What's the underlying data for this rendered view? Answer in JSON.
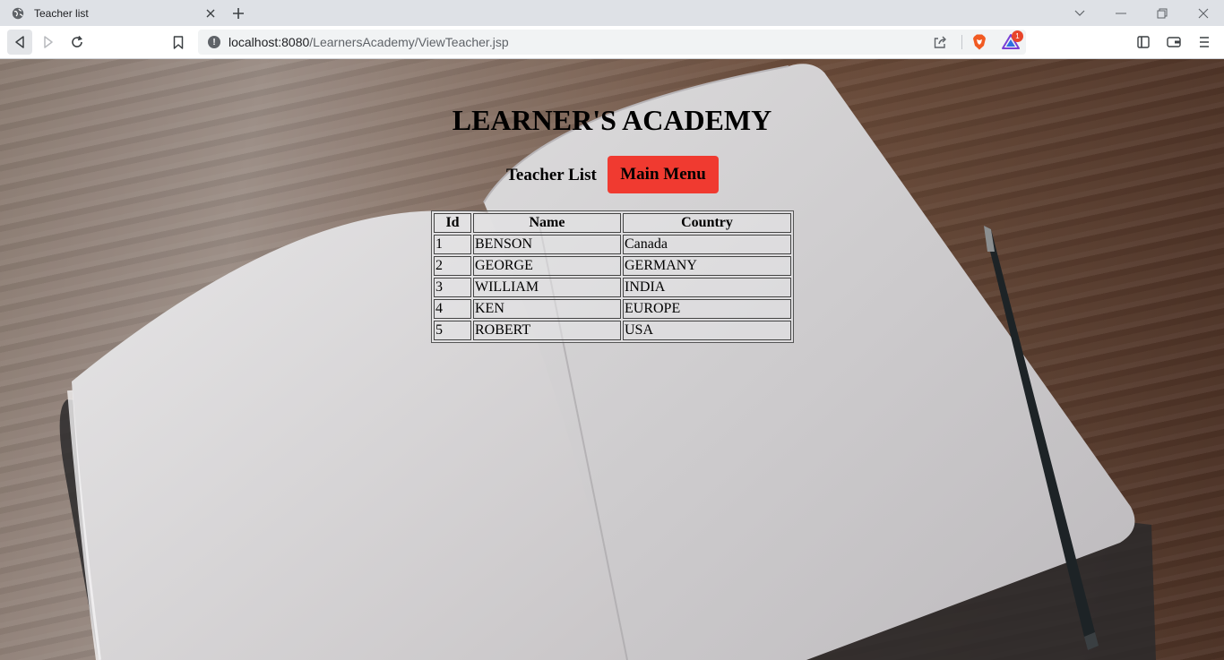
{
  "browser": {
    "tab_title": "Teacher list",
    "url_host": "localhost:8080",
    "url_path": "/LearnersAcademy/ViewTeacher.jsp",
    "rewards_badge": "1"
  },
  "page": {
    "title": "LEARNER'S ACADEMY",
    "subheading": "Teacher List",
    "main_menu_label": "Main Menu",
    "accent_color": "#f03a30"
  },
  "table": {
    "headers": [
      "Id",
      "Name",
      "Country"
    ],
    "rows": [
      [
        "1",
        "BENSON",
        "Canada"
      ],
      [
        "2",
        "GEORGE",
        "GERMANY"
      ],
      [
        "3",
        "WILLIAM",
        "INDIA"
      ],
      [
        "4",
        "KEN",
        "EUROPE"
      ],
      [
        "5",
        "ROBERT",
        "USA"
      ]
    ]
  }
}
